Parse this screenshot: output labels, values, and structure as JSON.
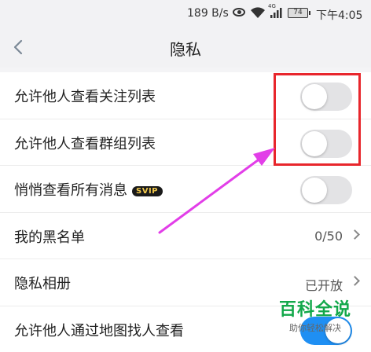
{
  "statusbar": {
    "speed": "189 B/s",
    "network": "4G",
    "battery": "74",
    "time": "下午4:05"
  },
  "navbar": {
    "back_icon": "chevron-left-icon",
    "title": "隐私"
  },
  "settings": [
    {
      "label": "允许他人查看关注列表",
      "control": "toggle",
      "on": false
    },
    {
      "label": "允许他人查看群组列表",
      "control": "toggle",
      "on": false
    },
    {
      "label": "悄悄查看所有消息",
      "badge": "SVIP",
      "control": "toggle",
      "on": false
    },
    {
      "label": "我的黑名单",
      "control": "link",
      "value": "0/50"
    },
    {
      "label": "隐私相册",
      "control": "link",
      "value": "已开放"
    },
    {
      "label": "允许他人通过地图找人查看",
      "control": "toggle",
      "on": true
    }
  ],
  "annotation": {
    "highlight_color": "#e8262c",
    "arrow_color": "#e23ee8"
  },
  "watermark": {
    "main": "百科全说",
    "sub": "助你轻松解决"
  },
  "colors": {
    "toggle_on": "#1f8ff3",
    "toggle_off": "#e3e3e5"
  }
}
